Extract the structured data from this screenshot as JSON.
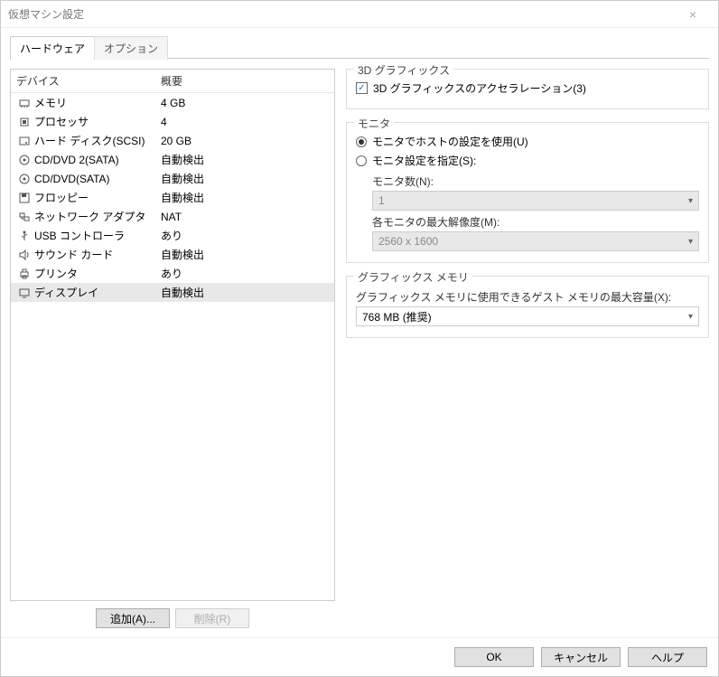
{
  "window": {
    "title": "仮想マシン設定"
  },
  "tabs": {
    "hardware": "ハードウェア",
    "options": "オプション"
  },
  "headers": {
    "device": "デバイス",
    "summary": "概要"
  },
  "devices": [
    {
      "icon": "memory-icon",
      "name": "メモリ",
      "summary": "4 GB"
    },
    {
      "icon": "cpu-icon",
      "name": "プロセッサ",
      "summary": "4"
    },
    {
      "icon": "hdd-icon",
      "name": "ハード ディスク(SCSI)",
      "summary": "20 GB"
    },
    {
      "icon": "disc-icon",
      "name": "CD/DVD 2(SATA)",
      "summary": "自動検出"
    },
    {
      "icon": "disc-icon",
      "name": "CD/DVD(SATA)",
      "summary": "自動検出"
    },
    {
      "icon": "floppy-icon",
      "name": "フロッピー",
      "summary": "自動検出"
    },
    {
      "icon": "network-icon",
      "name": "ネットワーク アダプタ",
      "summary": "NAT"
    },
    {
      "icon": "usb-icon",
      "name": "USB コントローラ",
      "summary": "あり"
    },
    {
      "icon": "sound-icon",
      "name": "サウンド カード",
      "summary": "自動検出"
    },
    {
      "icon": "printer-icon",
      "name": "プリンタ",
      "summary": "あり"
    },
    {
      "icon": "display-icon",
      "name": "ディスプレイ",
      "summary": "自動検出",
      "selected": true
    }
  ],
  "left_buttons": {
    "add": "追加(A)...",
    "remove": "削除(R)"
  },
  "graphics3d": {
    "group": "3D グラフィックス",
    "accelerate": "3D グラフィックスのアクセラレーション(3)"
  },
  "monitor": {
    "group": "モニタ",
    "use_host": "モニタでホストの設定を使用(U)",
    "specify": "モニタ設定を指定(S):",
    "count_label": "モニタ数(N):",
    "count_value": "1",
    "max_res_label": "各モニタの最大解像度(M):",
    "max_res_value": "2560 x 1600"
  },
  "gmem": {
    "group": "グラフィックス メモリ",
    "label": "グラフィックス メモリに使用できるゲスト メモリの最大容量(X):",
    "value": "768 MB (推奨)"
  },
  "footer": {
    "ok": "OK",
    "cancel": "キャンセル",
    "help": "ヘルプ"
  }
}
